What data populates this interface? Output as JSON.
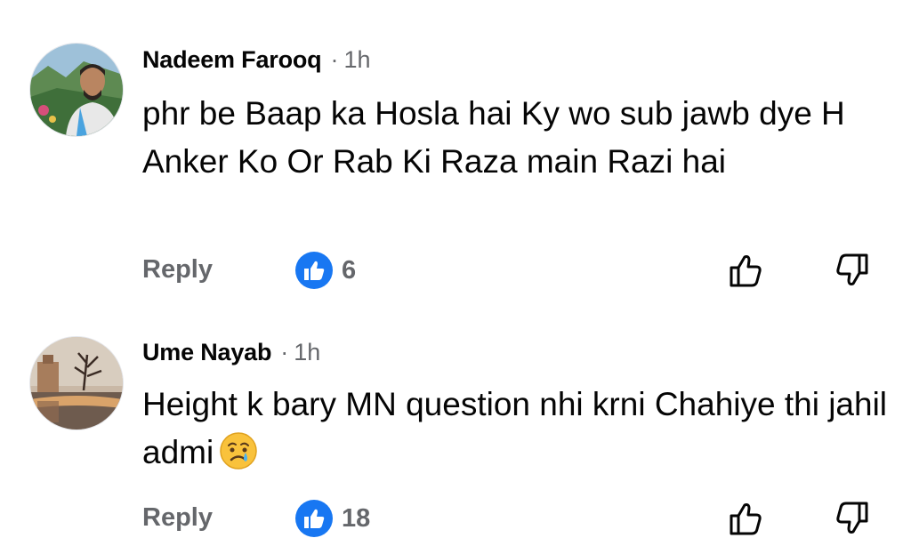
{
  "comments": [
    {
      "author": "Nadeem Farooq",
      "separator": "·",
      "time": "1h",
      "text": "phr be Baap ka Hosla hai Ky wo sub jawb dye H Anker Ko Or Rab Ki Raza main Razi hai",
      "reply_label": "Reply",
      "reaction_icon": "like-reaction-icon",
      "reaction_count": "6"
    },
    {
      "author": "Ume Nayab",
      "separator": "·",
      "time": "1h",
      "text": "Height k bary MN  question nhi krni Chahiye thi jahil admi",
      "emoji": "sad-tear-emoji",
      "reply_label": "Reply",
      "reaction_icon": "like-reaction-icon",
      "reaction_count": "18"
    }
  ],
  "colors": {
    "accent": "#1877f2",
    "secondary_text": "#65676b",
    "primary_text": "#050505"
  }
}
